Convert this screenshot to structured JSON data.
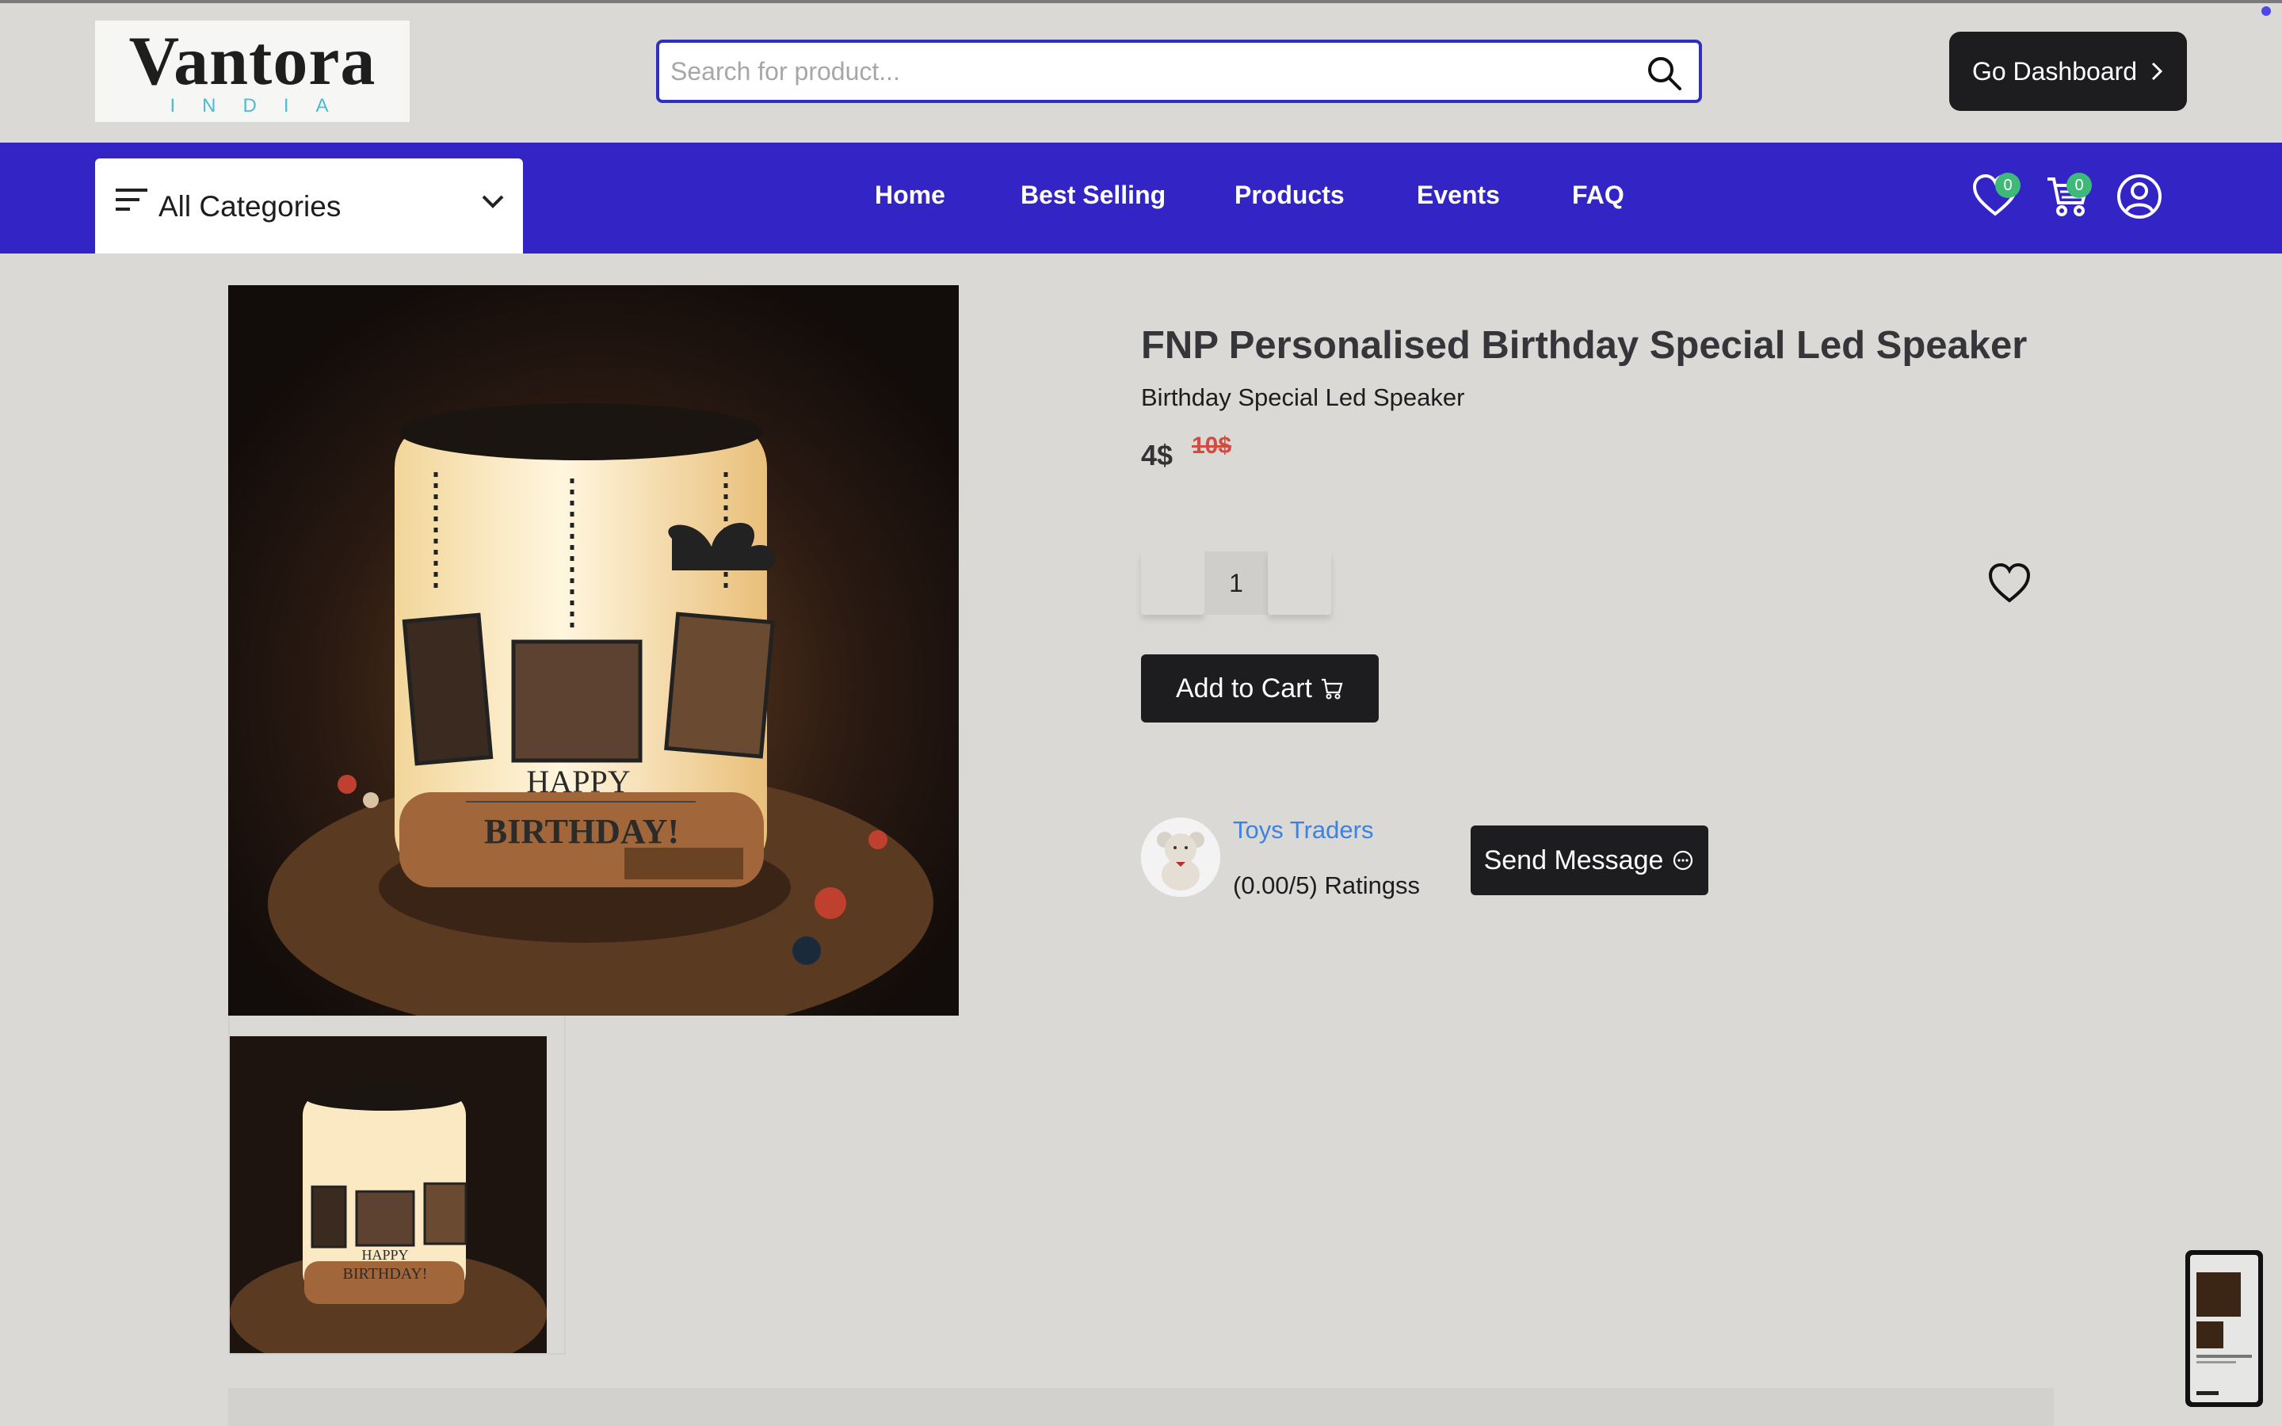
{
  "brand": {
    "name": "Vantora",
    "tagline": "INDIA"
  },
  "search": {
    "placeholder": "Search for product..."
  },
  "header": {
    "dashboard_label": "Go Dashboard"
  },
  "nav": {
    "categories_label": "All Categories",
    "links": [
      "Home",
      "Best Selling",
      "Products",
      "Events",
      "FAQ"
    ],
    "wishlist_count": "0",
    "cart_count": "0"
  },
  "product": {
    "title": "FNP Personalised Birthday Special Led Speaker",
    "subtitle": "Birthday Special Led Speaker",
    "price": "4$",
    "original_price": "10$",
    "quantity": "1",
    "add_to_cart_label": "Add to Cart",
    "image_text_line1": "HAPPY",
    "image_text_line2": "BIRTHDAY!"
  },
  "seller": {
    "name": "Toys Traders",
    "ratings": "(0.00/5) Ratingss",
    "message_label": "Send Message"
  },
  "colors": {
    "nav_bg": "#3224c5",
    "search_border": "#3030c0",
    "button_dark": "#1d1d1f",
    "badge_green": "#3fb97a",
    "link_blue": "#3e82e0",
    "strike_red": "#d34c42"
  }
}
